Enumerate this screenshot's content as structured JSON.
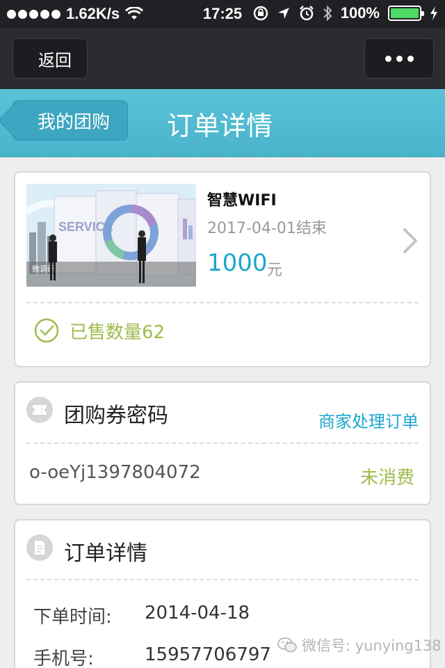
{
  "status_bar": {
    "network": "1.62K/s",
    "time": "17:25",
    "battery": "100%",
    "battery_level": 1.0,
    "battery_color": "#4cd964"
  },
  "navbar": {
    "back_label": "返回",
    "more_icon": "more-dots-icon"
  },
  "header": {
    "back_label": "我的团购",
    "title": "订单详情",
    "accent_color": "#5bc3d8"
  },
  "product": {
    "name": "智慧WIFI",
    "end_date": "2017-04-01结束",
    "price": "1000",
    "unit": "元",
    "sold_label": "已售数量62",
    "thumb_text": "SERVICE",
    "thumb_caption": "微调研"
  },
  "voucher": {
    "title": "团购券密码",
    "merchant_link": "商家处理订单",
    "code": "o-oeYj1397804072",
    "status": "未消费"
  },
  "order": {
    "title": "订单详情",
    "rows": [
      {
        "label": "下单时间:",
        "value": "2014-04-18"
      },
      {
        "label": "手机号:",
        "value": "15957706797"
      }
    ]
  },
  "watermark": "微信号: yunying138"
}
